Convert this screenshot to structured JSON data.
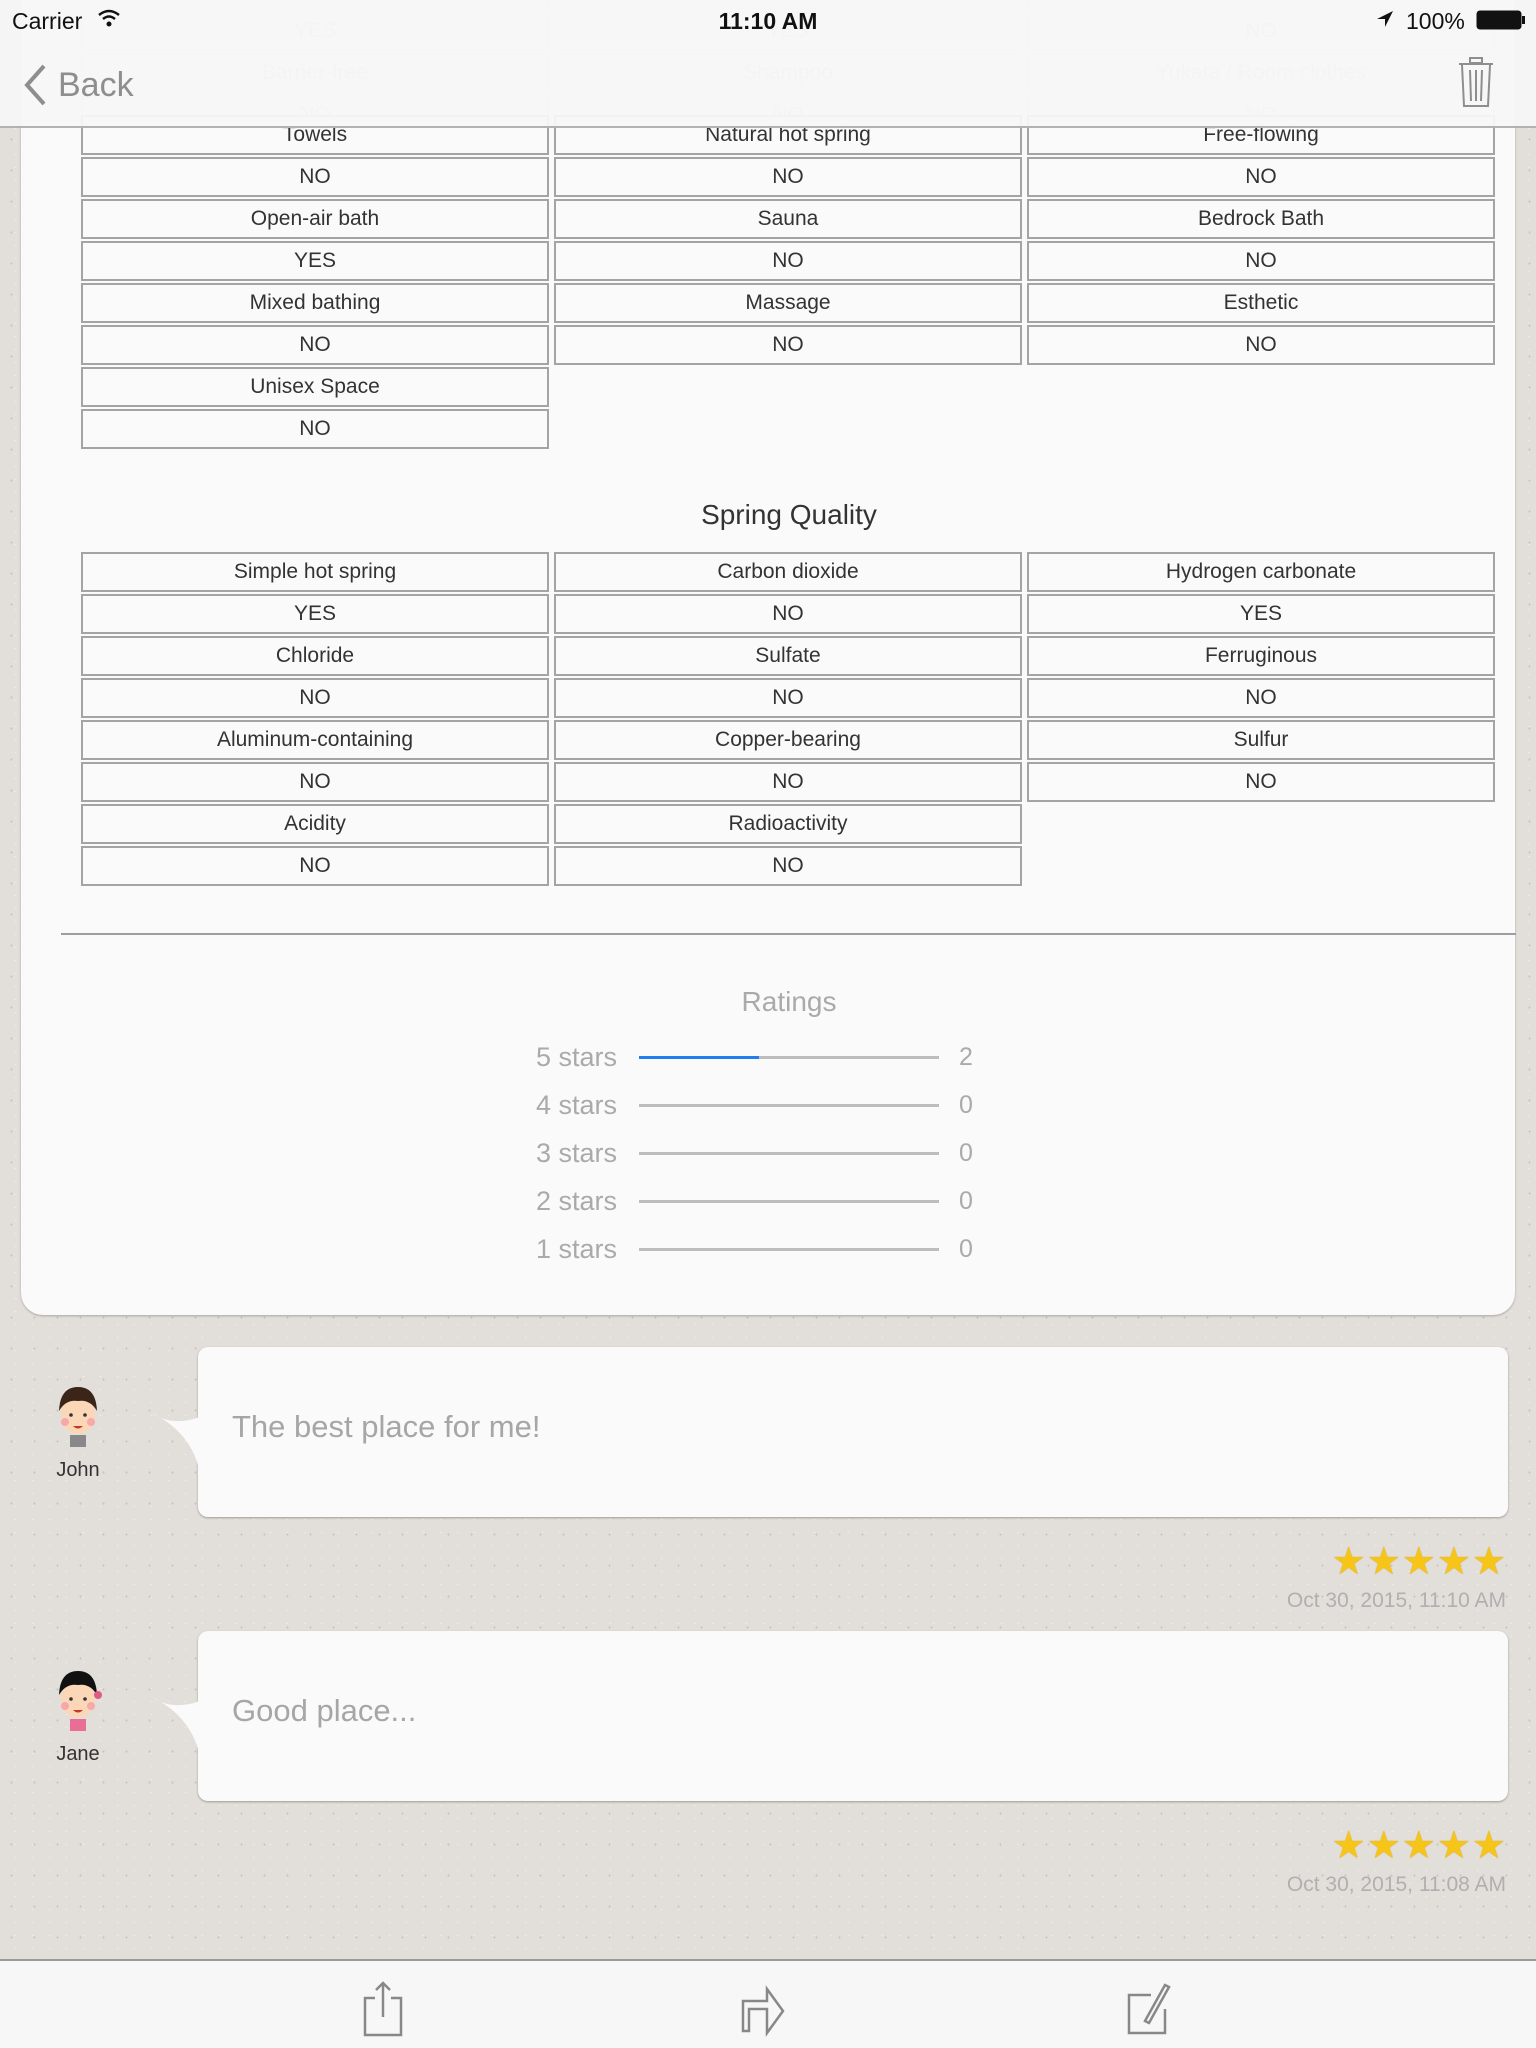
{
  "status_bar": {
    "carrier": "Carrier",
    "time": "11:10 AM",
    "battery": "100%"
  },
  "nav": {
    "back_label": "Back"
  },
  "facilities_ghost": [
    {
      "label": "",
      "value": "YES"
    },
    {
      "label": "",
      "value": "YES"
    },
    {
      "label": "",
      "value": "NO"
    },
    {
      "label": "Barrier-free",
      "value": "NO"
    },
    {
      "label": "Shampoo",
      "value": "NO"
    },
    {
      "label": "Yukata / Room clothes",
      "value": "NO"
    }
  ],
  "facilities": [
    {
      "label": "Towels",
      "value": "NO"
    },
    {
      "label": "Natural hot spring",
      "value": "NO"
    },
    {
      "label": "Free-flowing",
      "value": "NO"
    },
    {
      "label": "Open-air bath",
      "value": "YES"
    },
    {
      "label": "Sauna",
      "value": "NO"
    },
    {
      "label": "Bedrock Bath",
      "value": "NO"
    },
    {
      "label": "Mixed bathing",
      "value": "NO"
    },
    {
      "label": "Massage",
      "value": "NO"
    },
    {
      "label": "Esthetic",
      "value": "NO"
    },
    {
      "label": "Unisex Space",
      "value": "NO"
    }
  ],
  "spring_quality": {
    "title": "Spring Quality",
    "items": [
      {
        "label": "Simple hot spring",
        "value": "YES"
      },
      {
        "label": "Carbon dioxide",
        "value": "NO"
      },
      {
        "label": "Hydrogen carbonate",
        "value": "YES"
      },
      {
        "label": "Chloride",
        "value": "NO"
      },
      {
        "label": "Sulfate",
        "value": "NO"
      },
      {
        "label": "Ferruginous",
        "value": "NO"
      },
      {
        "label": "Aluminum-containing",
        "value": "NO"
      },
      {
        "label": "Copper-bearing",
        "value": "NO"
      },
      {
        "label": "Sulfur",
        "value": "NO"
      },
      {
        "label": "Acidity",
        "value": "NO"
      },
      {
        "label": "Radioactivity",
        "value": "NO"
      }
    ]
  },
  "ratings": {
    "title": "Ratings",
    "accent": "#1f7ff0",
    "rows": [
      {
        "label": "5 stars",
        "count": "2",
        "fraction": 0.4
      },
      {
        "label": "4 stars",
        "count": "0",
        "fraction": 0
      },
      {
        "label": "3 stars",
        "count": "0",
        "fraction": 0
      },
      {
        "label": "2 stars",
        "count": "0",
        "fraction": 0
      },
      {
        "label": "1 stars",
        "count": "0",
        "fraction": 0
      }
    ]
  },
  "comments": [
    {
      "name": "John",
      "avatar": "boy-avatar",
      "text": "The best place for me!",
      "stars": 5,
      "date": "Oct 30, 2015, 11:10 AM"
    },
    {
      "name": "Jane",
      "avatar": "girl-avatar",
      "text": "Good place...",
      "stars": 5,
      "date": "Oct 30, 2015, 11:08 AM"
    }
  ],
  "toolbar": {
    "icons": [
      "share-icon",
      "forward-icon",
      "compose-icon"
    ]
  }
}
